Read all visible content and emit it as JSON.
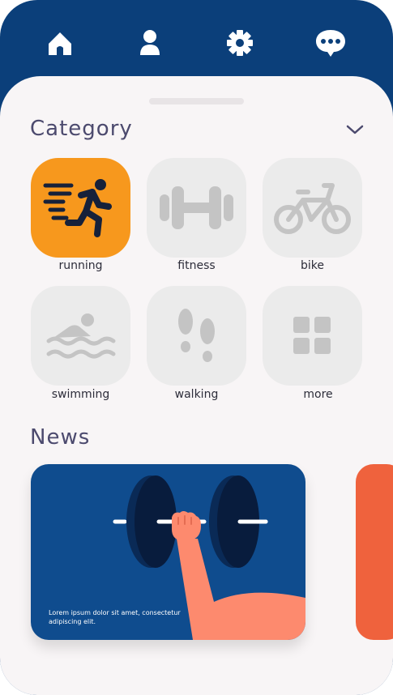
{
  "nav": {
    "items": [
      {
        "name": "home",
        "icon": "home-icon"
      },
      {
        "name": "profile",
        "icon": "user-icon"
      },
      {
        "name": "settings",
        "icon": "gear-icon"
      },
      {
        "name": "messages",
        "icon": "chat-bubble-icon"
      }
    ]
  },
  "category": {
    "title": "Category",
    "items": [
      {
        "label": "running",
        "icon": "running-icon",
        "selected": true
      },
      {
        "label": "fitness",
        "icon": "dumbbell-icon",
        "selected": false
      },
      {
        "label": "bike",
        "icon": "bicycle-icon",
        "selected": false
      },
      {
        "label": "swimming",
        "icon": "swimming-icon",
        "selected": false
      },
      {
        "label": "walking",
        "icon": "footprints-icon",
        "selected": false
      },
      {
        "label": "more",
        "icon": "grid-icon",
        "selected": false
      }
    ]
  },
  "news": {
    "title": "News",
    "cards": [
      {
        "text": "Lorem ipsum dolor sit amet, consectetur adipiscing elit.",
        "color": "#0f4c8e"
      },
      {
        "text": "",
        "color": "#ef623d"
      }
    ]
  },
  "colors": {
    "header": "#0b3f7a",
    "accent": "#f7981d",
    "tile": "#ebebeb",
    "title": "#4c4a6e",
    "icon_gray": "#c4c4c4"
  }
}
